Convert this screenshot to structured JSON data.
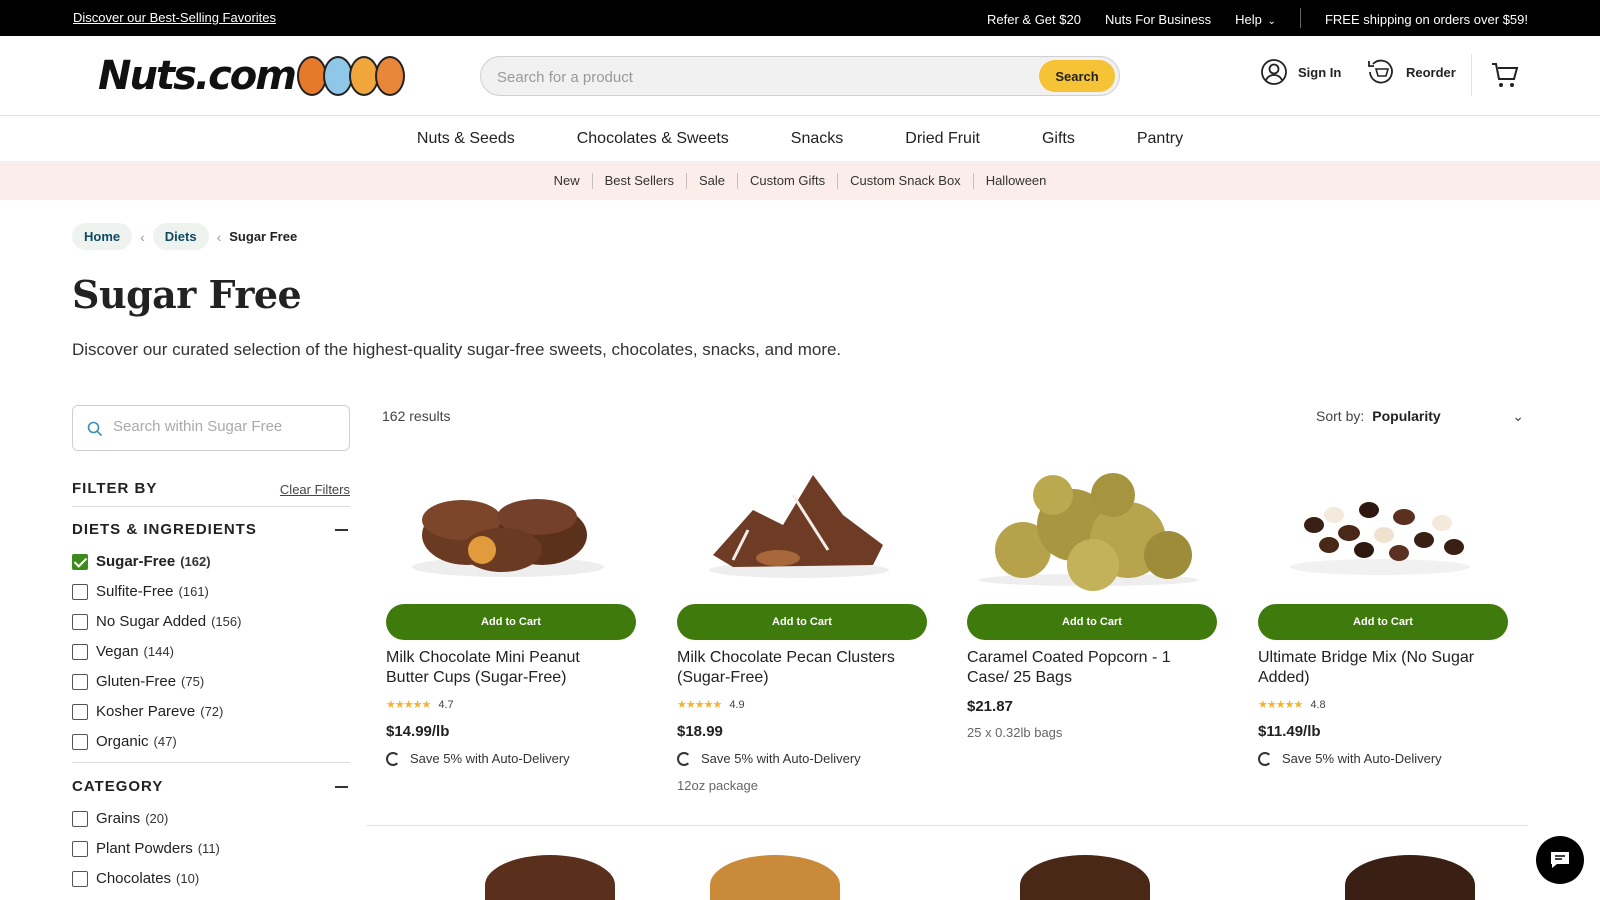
{
  "topbar": {
    "promo": "Discover our Best-Selling Favorites",
    "refer": "Refer & Get $20",
    "business": "Nuts For Business",
    "help": "Help",
    "shipping": "FREE shipping on orders over $59!"
  },
  "header": {
    "logo_text": "Nuts.com",
    "search_placeholder": "Search for a product",
    "search_button": "Search",
    "sign_in": "Sign In",
    "reorder": "Reorder"
  },
  "nav": [
    "Nuts & Seeds",
    "Chocolates & Sweets",
    "Snacks",
    "Dried Fruit",
    "Gifts",
    "Pantry"
  ],
  "subnav": [
    "New",
    "Best Sellers",
    "Sale",
    "Custom Gifts",
    "Custom Snack Box",
    "Halloween"
  ],
  "breadcrumb": {
    "home": "Home",
    "diets": "Diets",
    "current": "Sugar Free"
  },
  "page": {
    "title": "Sugar Free",
    "description": "Discover our curated selection of the highest-quality sugar-free sweets, chocolates, snacks, and more."
  },
  "sidebar": {
    "search_placeholder": "Search within Sugar Free",
    "filter_by": "FILTER BY",
    "clear": "Clear Filters",
    "diets_heading": "DIETS & INGREDIENTS",
    "diets": [
      {
        "label": "Sugar-Free",
        "count": "(162)",
        "checked": true
      },
      {
        "label": "Sulfite-Free",
        "count": "(161)",
        "checked": false
      },
      {
        "label": "No Sugar Added",
        "count": "(156)",
        "checked": false
      },
      {
        "label": "Vegan",
        "count": "(144)",
        "checked": false
      },
      {
        "label": "Gluten-Free",
        "count": "(75)",
        "checked": false
      },
      {
        "label": "Kosher Pareve",
        "count": "(72)",
        "checked": false
      },
      {
        "label": "Organic",
        "count": "(47)",
        "checked": false
      }
    ],
    "category_heading": "CATEGORY",
    "categories": [
      {
        "label": "Grains",
        "count": "(20)"
      },
      {
        "label": "Plant Powders",
        "count": "(11)"
      },
      {
        "label": "Chocolates",
        "count": "(10)"
      }
    ]
  },
  "results": {
    "count": "162 results",
    "sort_label": "Sort by:",
    "sort_value": "Popularity",
    "add_label": "Add to Cart",
    "products": [
      {
        "name": "Milk Chocolate Mini Peanut Butter Cups (Sugar-Free)",
        "rating": "4.7",
        "price": "$14.99/lb",
        "auto": "Save 5% with Auto-Delivery",
        "note": ""
      },
      {
        "name": "Milk Chocolate Pecan Clusters (Sugar-Free)",
        "rating": "4.9",
        "price": "$18.99",
        "auto": "Save 5% with Auto-Delivery",
        "note": "12oz package"
      },
      {
        "name": "Caramel Coated Popcorn - 1 Case/ 25 Bags",
        "rating": "",
        "price": "$21.87",
        "auto": "",
        "note": "25 x 0.32lb bags"
      },
      {
        "name": "Ultimate Bridge Mix (No Sugar Added)",
        "rating": "4.8",
        "price": "$11.49/lb",
        "auto": "Save 5% with Auto-Delivery",
        "note": ""
      }
    ]
  },
  "colors": {
    "accent_green": "#3f7a0c",
    "search_yellow": "#f6c336",
    "subnav_bg": "#fbeeea"
  },
  "icons": [
    "account-icon",
    "reorder-icon",
    "cart-icon",
    "search-icon",
    "chat-icon",
    "chevron-down-icon"
  ]
}
